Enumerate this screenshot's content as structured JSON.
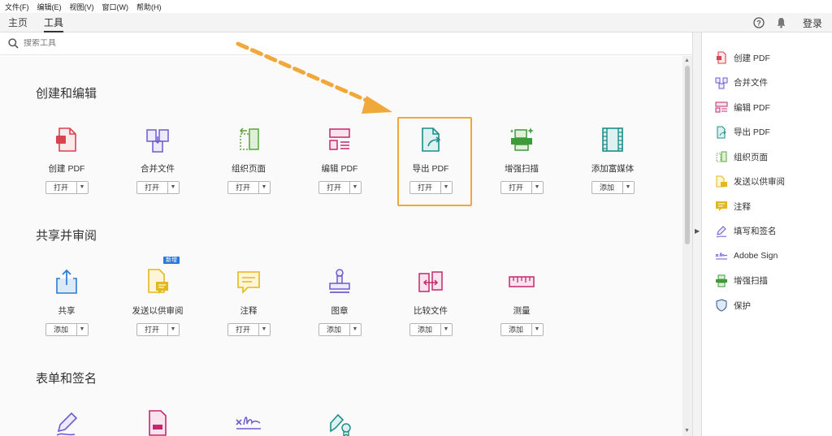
{
  "menu": [
    "文件(F)",
    "编辑(E)",
    "视图(V)",
    "窗口(W)",
    "帮助(H)"
  ],
  "nav": {
    "tabs": [
      "主页",
      "工具"
    ],
    "active_tab": "工具",
    "login": "登录"
  },
  "search": {
    "placeholder": "搜索工具"
  },
  "sections": [
    {
      "title": "创建和编辑",
      "tools": [
        {
          "label": "创建 PDF",
          "button": "打开",
          "icon": "create-pdf-icon"
        },
        {
          "label": "合并文件",
          "button": "打开",
          "icon": "combine-files-icon"
        },
        {
          "label": "组织页面",
          "button": "打开",
          "icon": "organize-pages-icon"
        },
        {
          "label": "编辑 PDF",
          "button": "打开",
          "icon": "edit-pdf-icon"
        },
        {
          "label": "导出 PDF",
          "button": "打开",
          "icon": "export-pdf-icon"
        },
        {
          "label": "增强扫描",
          "button": "打开",
          "icon": "enhance-scan-icon"
        },
        {
          "label": "添加富媒体",
          "button": "添加",
          "icon": "rich-media-icon"
        }
      ]
    },
    {
      "title": "共享并审阅",
      "tools": [
        {
          "label": "共享",
          "button": "添加",
          "icon": "share-icon"
        },
        {
          "label": "发送以供审阅",
          "button": "打开",
          "icon": "send-review-icon",
          "badge": "新增"
        },
        {
          "label": "注释",
          "button": "打开",
          "icon": "comment-icon"
        },
        {
          "label": "图章",
          "button": "添加",
          "icon": "stamp-icon"
        },
        {
          "label": "比较文件",
          "button": "添加",
          "icon": "compare-files-icon"
        },
        {
          "label": "测量",
          "button": "添加",
          "icon": "measure-icon"
        }
      ]
    },
    {
      "title": "表单和签名",
      "tools": [
        {
          "icon": "fill-sign-icon"
        },
        {
          "icon": "prepare-form-icon"
        },
        {
          "icon": "adobe-sign-icon"
        },
        {
          "icon": "certificate-icon"
        }
      ]
    }
  ],
  "right_panel": [
    {
      "label": "创建 PDF",
      "icon": "create-pdf-icon"
    },
    {
      "label": "合并文件",
      "icon": "combine-files-icon"
    },
    {
      "label": "编辑 PDF",
      "icon": "edit-pdf-icon"
    },
    {
      "label": "导出 PDF",
      "icon": "export-pdf-icon"
    },
    {
      "label": "组织页面",
      "icon": "organize-pages-icon"
    },
    {
      "label": "发送以供审阅",
      "icon": "send-review-icon"
    },
    {
      "label": "注释",
      "icon": "comment-icon"
    },
    {
      "label": "填写和签名",
      "icon": "fill-sign-icon"
    },
    {
      "label": "Adobe Sign",
      "icon": "adobe-sign-icon"
    },
    {
      "label": "增强扫描",
      "icon": "enhance-scan-icon"
    },
    {
      "label": "保护",
      "icon": "protect-icon"
    }
  ],
  "colors": {
    "red": "#d9434f",
    "purple": "#6d5bd0",
    "green": "#5aa83b",
    "magenta": "#c2286e",
    "teal": "#1f8d8a",
    "blue": "#2a7bd6",
    "yellow": "#e3b81c",
    "highlight": "#f0a83a"
  }
}
